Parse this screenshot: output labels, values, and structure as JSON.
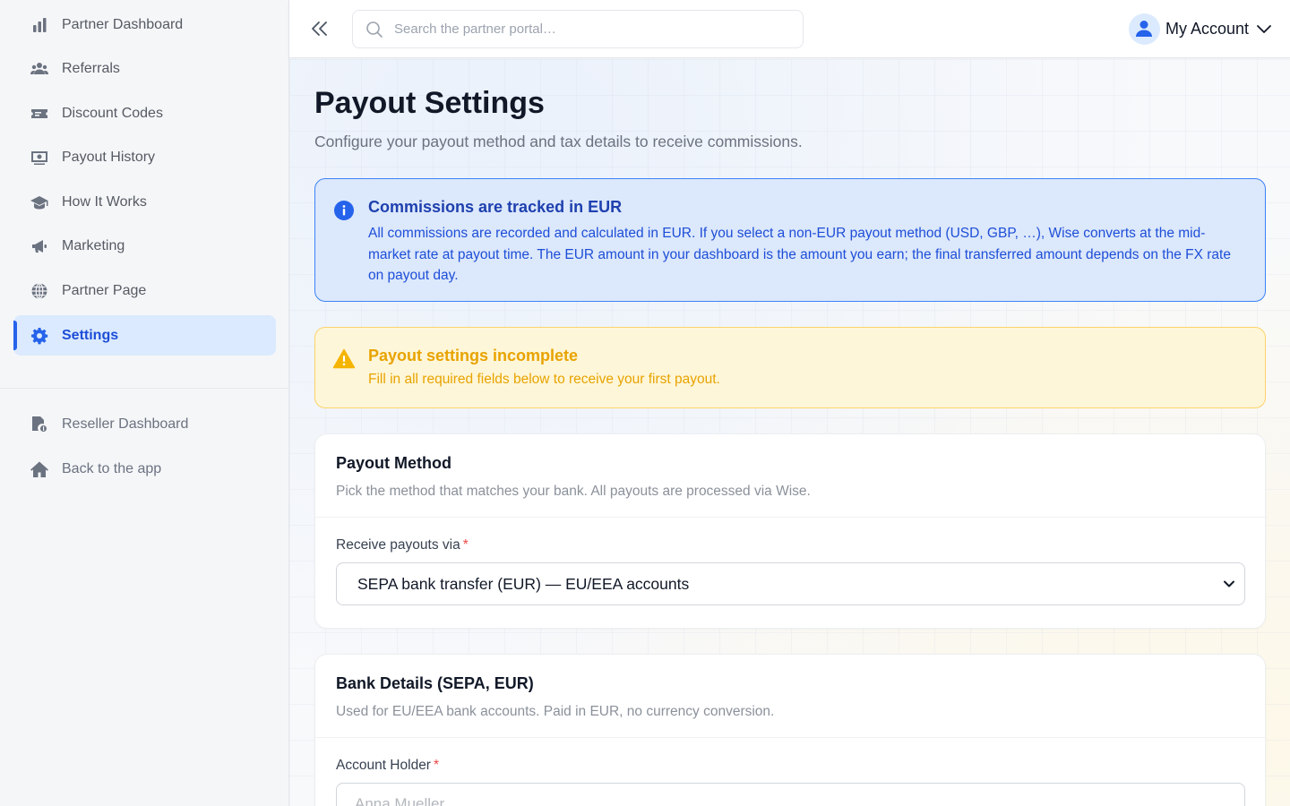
{
  "sidebar": {
    "items": [
      {
        "label": "Partner Dashboard",
        "icon": "bar-chart-icon"
      },
      {
        "label": "Referrals",
        "icon": "users-icon"
      },
      {
        "label": "Discount Codes",
        "icon": "ticket-icon"
      },
      {
        "label": "Payout History",
        "icon": "money-bill-icon"
      },
      {
        "label": "How It Works",
        "icon": "graduation-cap-icon"
      },
      {
        "label": "Marketing",
        "icon": "megaphone-icon"
      },
      {
        "label": "Partner Page",
        "icon": "globe-icon"
      },
      {
        "label": "Settings",
        "icon": "gear-icon",
        "active": true
      }
    ],
    "secondary": [
      {
        "label": "Reseller Dashboard",
        "icon": "reseller-icon"
      },
      {
        "label": "Back to the app",
        "icon": "home-icon"
      }
    ]
  },
  "topbar": {
    "search_placeholder": "Search the partner portal…",
    "account_label": "My Account"
  },
  "page": {
    "title": "Payout Settings",
    "subtitle": "Configure your payout method and tax details to receive commissions."
  },
  "alerts": {
    "info": {
      "title": "Commissions are tracked in EUR",
      "body": "All commissions are recorded and calculated in EUR. If you select a non-EUR payout method (USD, GBP, …), Wise converts at the mid-market rate at payout time. The EUR amount in your dashboard is the amount you earn; the final transferred amount depends on the FX rate on payout day."
    },
    "warning": {
      "title": "Payout settings incomplete",
      "body": "Fill in all required fields below to receive your first payout."
    }
  },
  "payout_method": {
    "title": "Payout Method",
    "description": "Pick the method that matches your bank. All payouts are processed via Wise.",
    "field_label": "Receive payouts via",
    "required_mark": "*",
    "selected": "SEPA bank transfer (EUR) — EU/EEA accounts"
  },
  "bank_details": {
    "title": "Bank Details (SEPA, EUR)",
    "description": "Used for EU/EEA bank accounts. Paid in EUR, no currency conversion.",
    "field_label": "Account Holder",
    "required_mark": "*",
    "placeholder": "Anna Mueller"
  },
  "colors": {
    "accent": "#2563eb",
    "info_bg": "#dce8fb",
    "warning_text": "#e8a300",
    "required": "#ef4444"
  }
}
